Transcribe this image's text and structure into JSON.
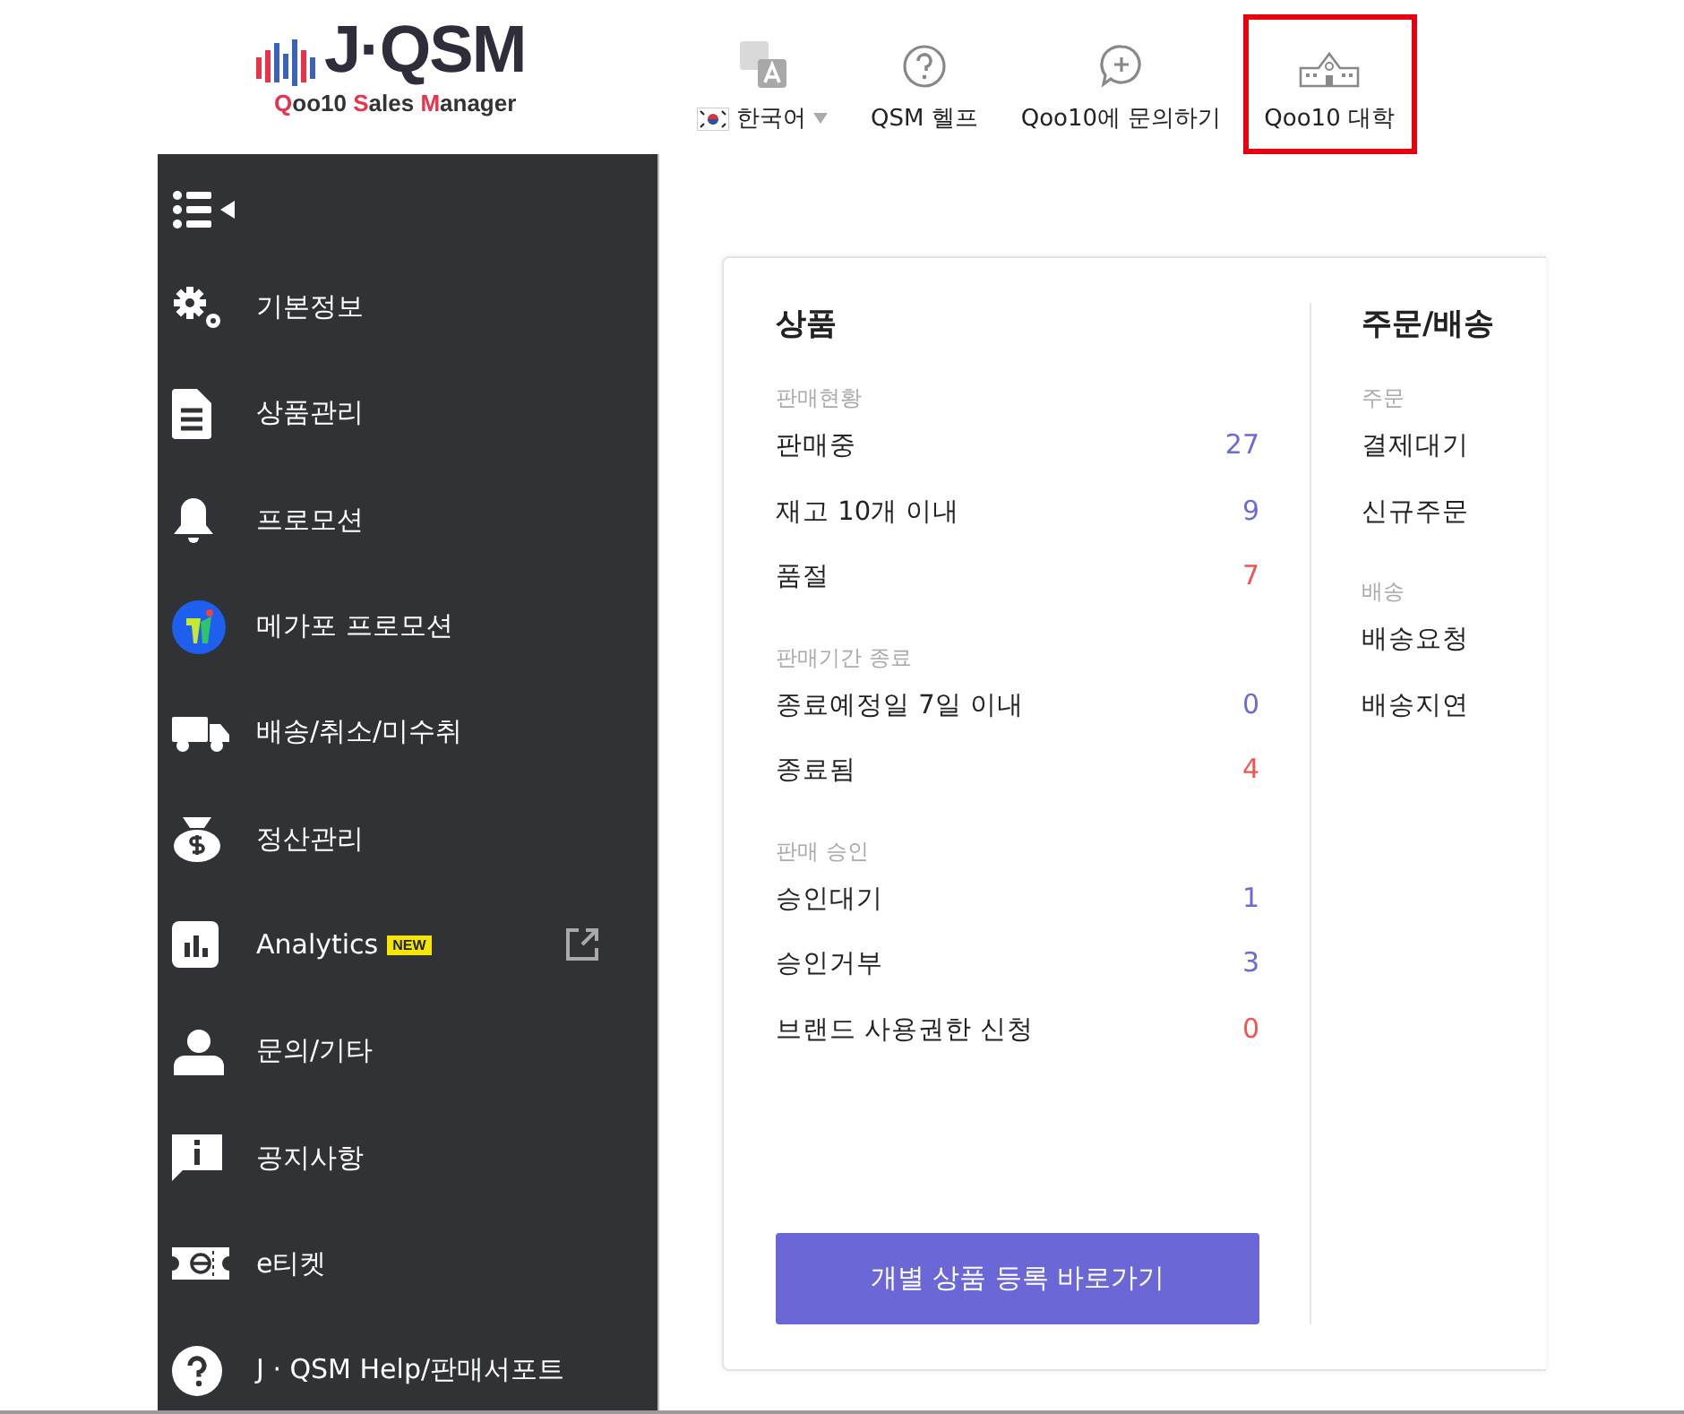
{
  "logo": {
    "title": "J·QSM",
    "subtitle_parts": [
      {
        "text": "Q",
        "accent": true
      },
      {
        "text": "oo10 ",
        "accent": false
      },
      {
        "text": "S",
        "accent": true
      },
      {
        "text": "ales ",
        "accent": false
      },
      {
        "text": "M",
        "accent": true
      },
      {
        "text": "anager",
        "accent": false
      }
    ]
  },
  "top_nav": [
    {
      "kind": "language",
      "label": "한국어",
      "highlighted": false
    },
    {
      "kind": "help",
      "label": "QSM 헬프",
      "highlighted": false
    },
    {
      "kind": "inquiry",
      "label": "Qoo10에 문의하기",
      "highlighted": false
    },
    {
      "kind": "school",
      "label": "Qoo10 대학",
      "highlighted": true
    }
  ],
  "sidebar": {
    "items": [
      {
        "kind": "gears",
        "label": "기본정보",
        "external": false
      },
      {
        "kind": "document",
        "label": "상품관리",
        "external": false
      },
      {
        "kind": "bell",
        "label": "프로모션",
        "external": false
      },
      {
        "kind": "mega",
        "label": "메가포 프로모션",
        "external": false
      },
      {
        "kind": "truck",
        "label": "배송/취소/미수취",
        "external": false
      },
      {
        "kind": "moneybag",
        "label": "정산관리",
        "external": false
      },
      {
        "kind": "chart",
        "label": "Analytics",
        "badge": "NEW",
        "external": true
      },
      {
        "kind": "person",
        "label": "문의/기타",
        "external": false
      },
      {
        "kind": "notice",
        "label": "공지사항",
        "external": false
      },
      {
        "kind": "ticket",
        "label": "e티켓",
        "external": false
      },
      {
        "kind": "help",
        "label": "J · QSM Help/판매서포트",
        "external": false
      }
    ]
  },
  "dashboard": {
    "sections": [
      {
        "title": "상품",
        "groups": [
          {
            "label": "판매현황",
            "rows": [
              {
                "label": "판매중",
                "count": "27",
                "color": "#6b6bd6"
              },
              {
                "label": "재고 10개 이내",
                "count": "9",
                "color": "#6b6bd6"
              },
              {
                "label": "품절",
                "count": "7",
                "color": "#f05454"
              }
            ]
          },
          {
            "label": "판매기간 종료",
            "rows": [
              {
                "label": "종료예정일 7일 이내",
                "count": "0",
                "color": "#6b6bd6"
              },
              {
                "label": "종료됨",
                "count": "4",
                "color": "#f05454"
              }
            ]
          },
          {
            "label": "판매 승인",
            "rows": [
              {
                "label": "승인대기",
                "count": "1",
                "color": "#6b6bd6"
              },
              {
                "label": "승인거부",
                "count": "3",
                "color": "#6b6bd6"
              },
              {
                "label": "브랜드 사용권한 신청",
                "count": "0",
                "color": "#f05454"
              }
            ]
          }
        ],
        "button": "개별 상품 등록 바로가기"
      },
      {
        "title": "주문/배송",
        "groups": [
          {
            "label": "주문",
            "rows": [
              {
                "label": "결제대기"
              },
              {
                "label": "신규주문"
              }
            ]
          },
          {
            "label": "배송",
            "rows": [
              {
                "label": "배송요청"
              },
              {
                "label": "배송지연"
              }
            ]
          }
        ]
      }
    ]
  }
}
